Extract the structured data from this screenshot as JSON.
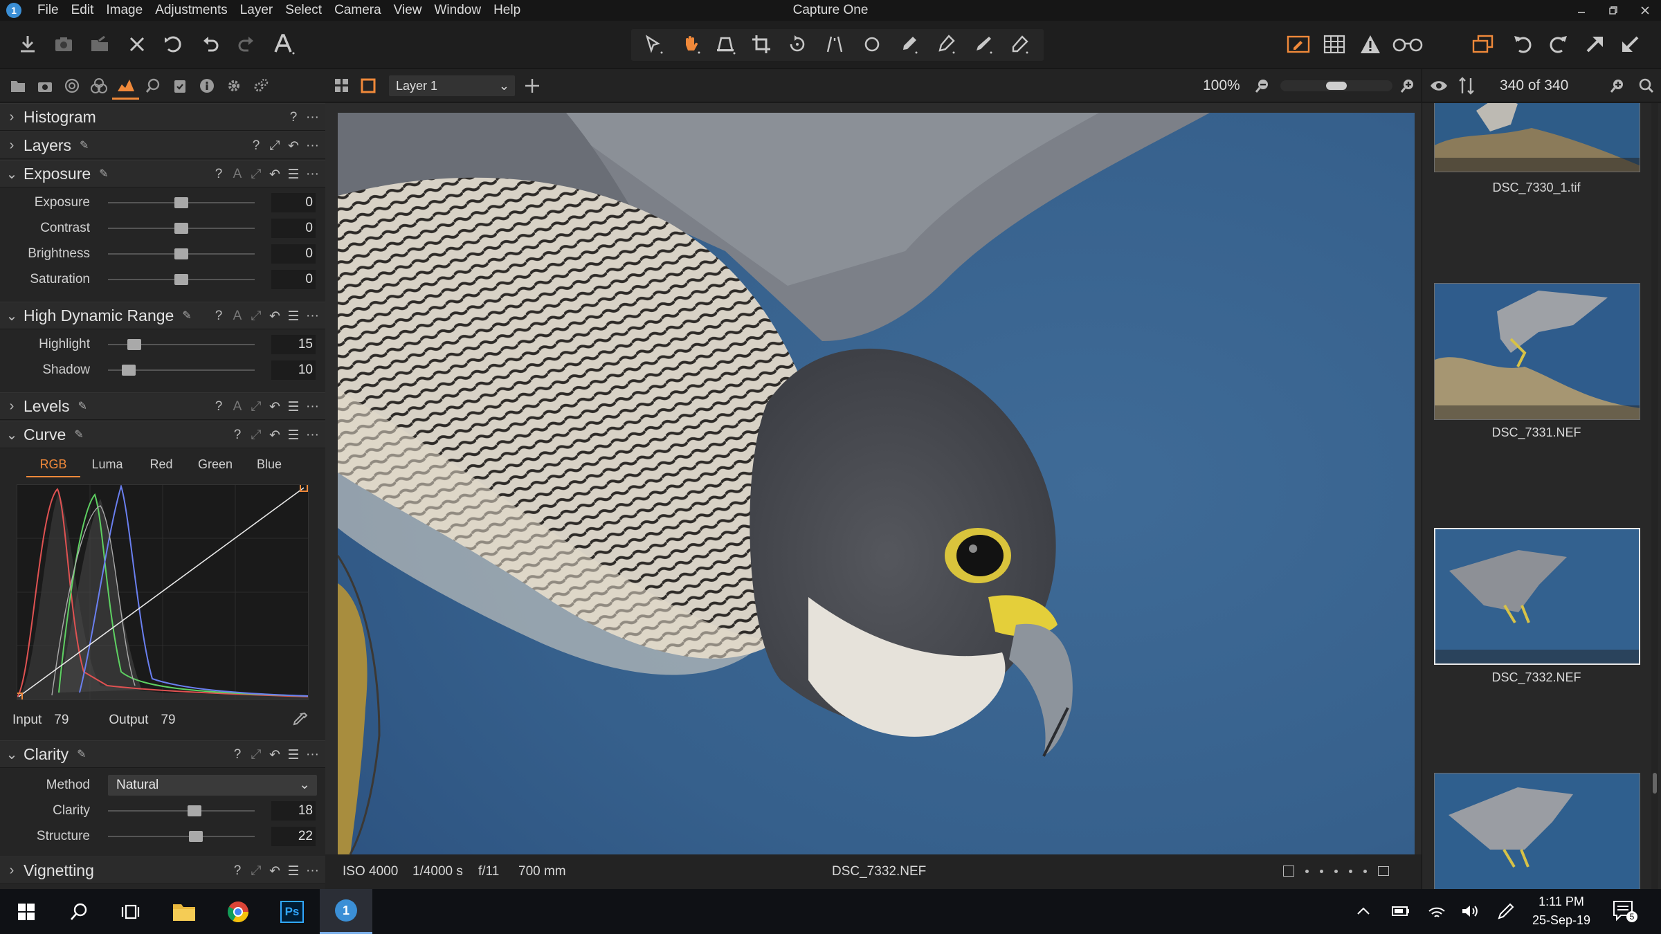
{
  "app": {
    "title": "Capture One",
    "logo": "1"
  },
  "menu": [
    "File",
    "Edit",
    "Image",
    "Adjustments",
    "Layer",
    "Select",
    "Camera",
    "View",
    "Window",
    "Help"
  ],
  "viewer": {
    "layer_select": "Layer 1",
    "zoom": "100%",
    "zoom_level": 0.5,
    "count": "340 of 340",
    "info": {
      "iso": "ISO 4000",
      "shutter": "1/4000 s",
      "aperture": "f/11",
      "focal": "700 mm",
      "filename": "DSC_7332.NEF"
    }
  },
  "panel": {
    "histogram": {
      "title": "Histogram"
    },
    "layers": {
      "title": "Layers"
    },
    "exposure": {
      "title": "Exposure",
      "rows": [
        {
          "label": "Exposure",
          "value": "0",
          "pos": 0.5
        },
        {
          "label": "Contrast",
          "value": "0",
          "pos": 0.5
        },
        {
          "label": "Brightness",
          "value": "0",
          "pos": 0.5
        },
        {
          "label": "Saturation",
          "value": "0",
          "pos": 0.5
        }
      ]
    },
    "hdr": {
      "title": "High Dynamic Range",
      "rows": [
        {
          "label": "Highlight",
          "value": "15",
          "pos": 0.18
        },
        {
          "label": "Shadow",
          "value": "10",
          "pos": 0.14
        }
      ]
    },
    "levels": {
      "title": "Levels"
    },
    "curve": {
      "title": "Curve",
      "tabs": [
        "RGB",
        "Luma",
        "Red",
        "Green",
        "Blue"
      ],
      "input_label": "Input",
      "input_value": "79",
      "output_label": "Output",
      "output_value": "79"
    },
    "clarity": {
      "title": "Clarity",
      "method_label": "Method",
      "method_value": "Natural",
      "rows": [
        {
          "label": "Clarity",
          "value": "18",
          "pos": 0.59
        },
        {
          "label": "Structure",
          "value": "22",
          "pos": 0.6
        }
      ]
    },
    "vignetting": {
      "title": "Vignetting"
    },
    "help": "?",
    "auto": "A",
    "more": "···"
  },
  "browser": {
    "thumbs": [
      {
        "name": "DSC_7330_1.tif"
      },
      {
        "name": "DSC_7331.NEF"
      },
      {
        "name": "DSC_7332.NEF"
      },
      {
        "name": ""
      }
    ]
  },
  "taskbar": {
    "time": "1:11 PM",
    "date": "25-Sep-19",
    "notifications": "5",
    "ps": "Ps",
    "c1": "1"
  },
  "colors": {
    "accent": "#f0893a",
    "selection": "#e8e8e8",
    "sky": "#3d6792"
  }
}
